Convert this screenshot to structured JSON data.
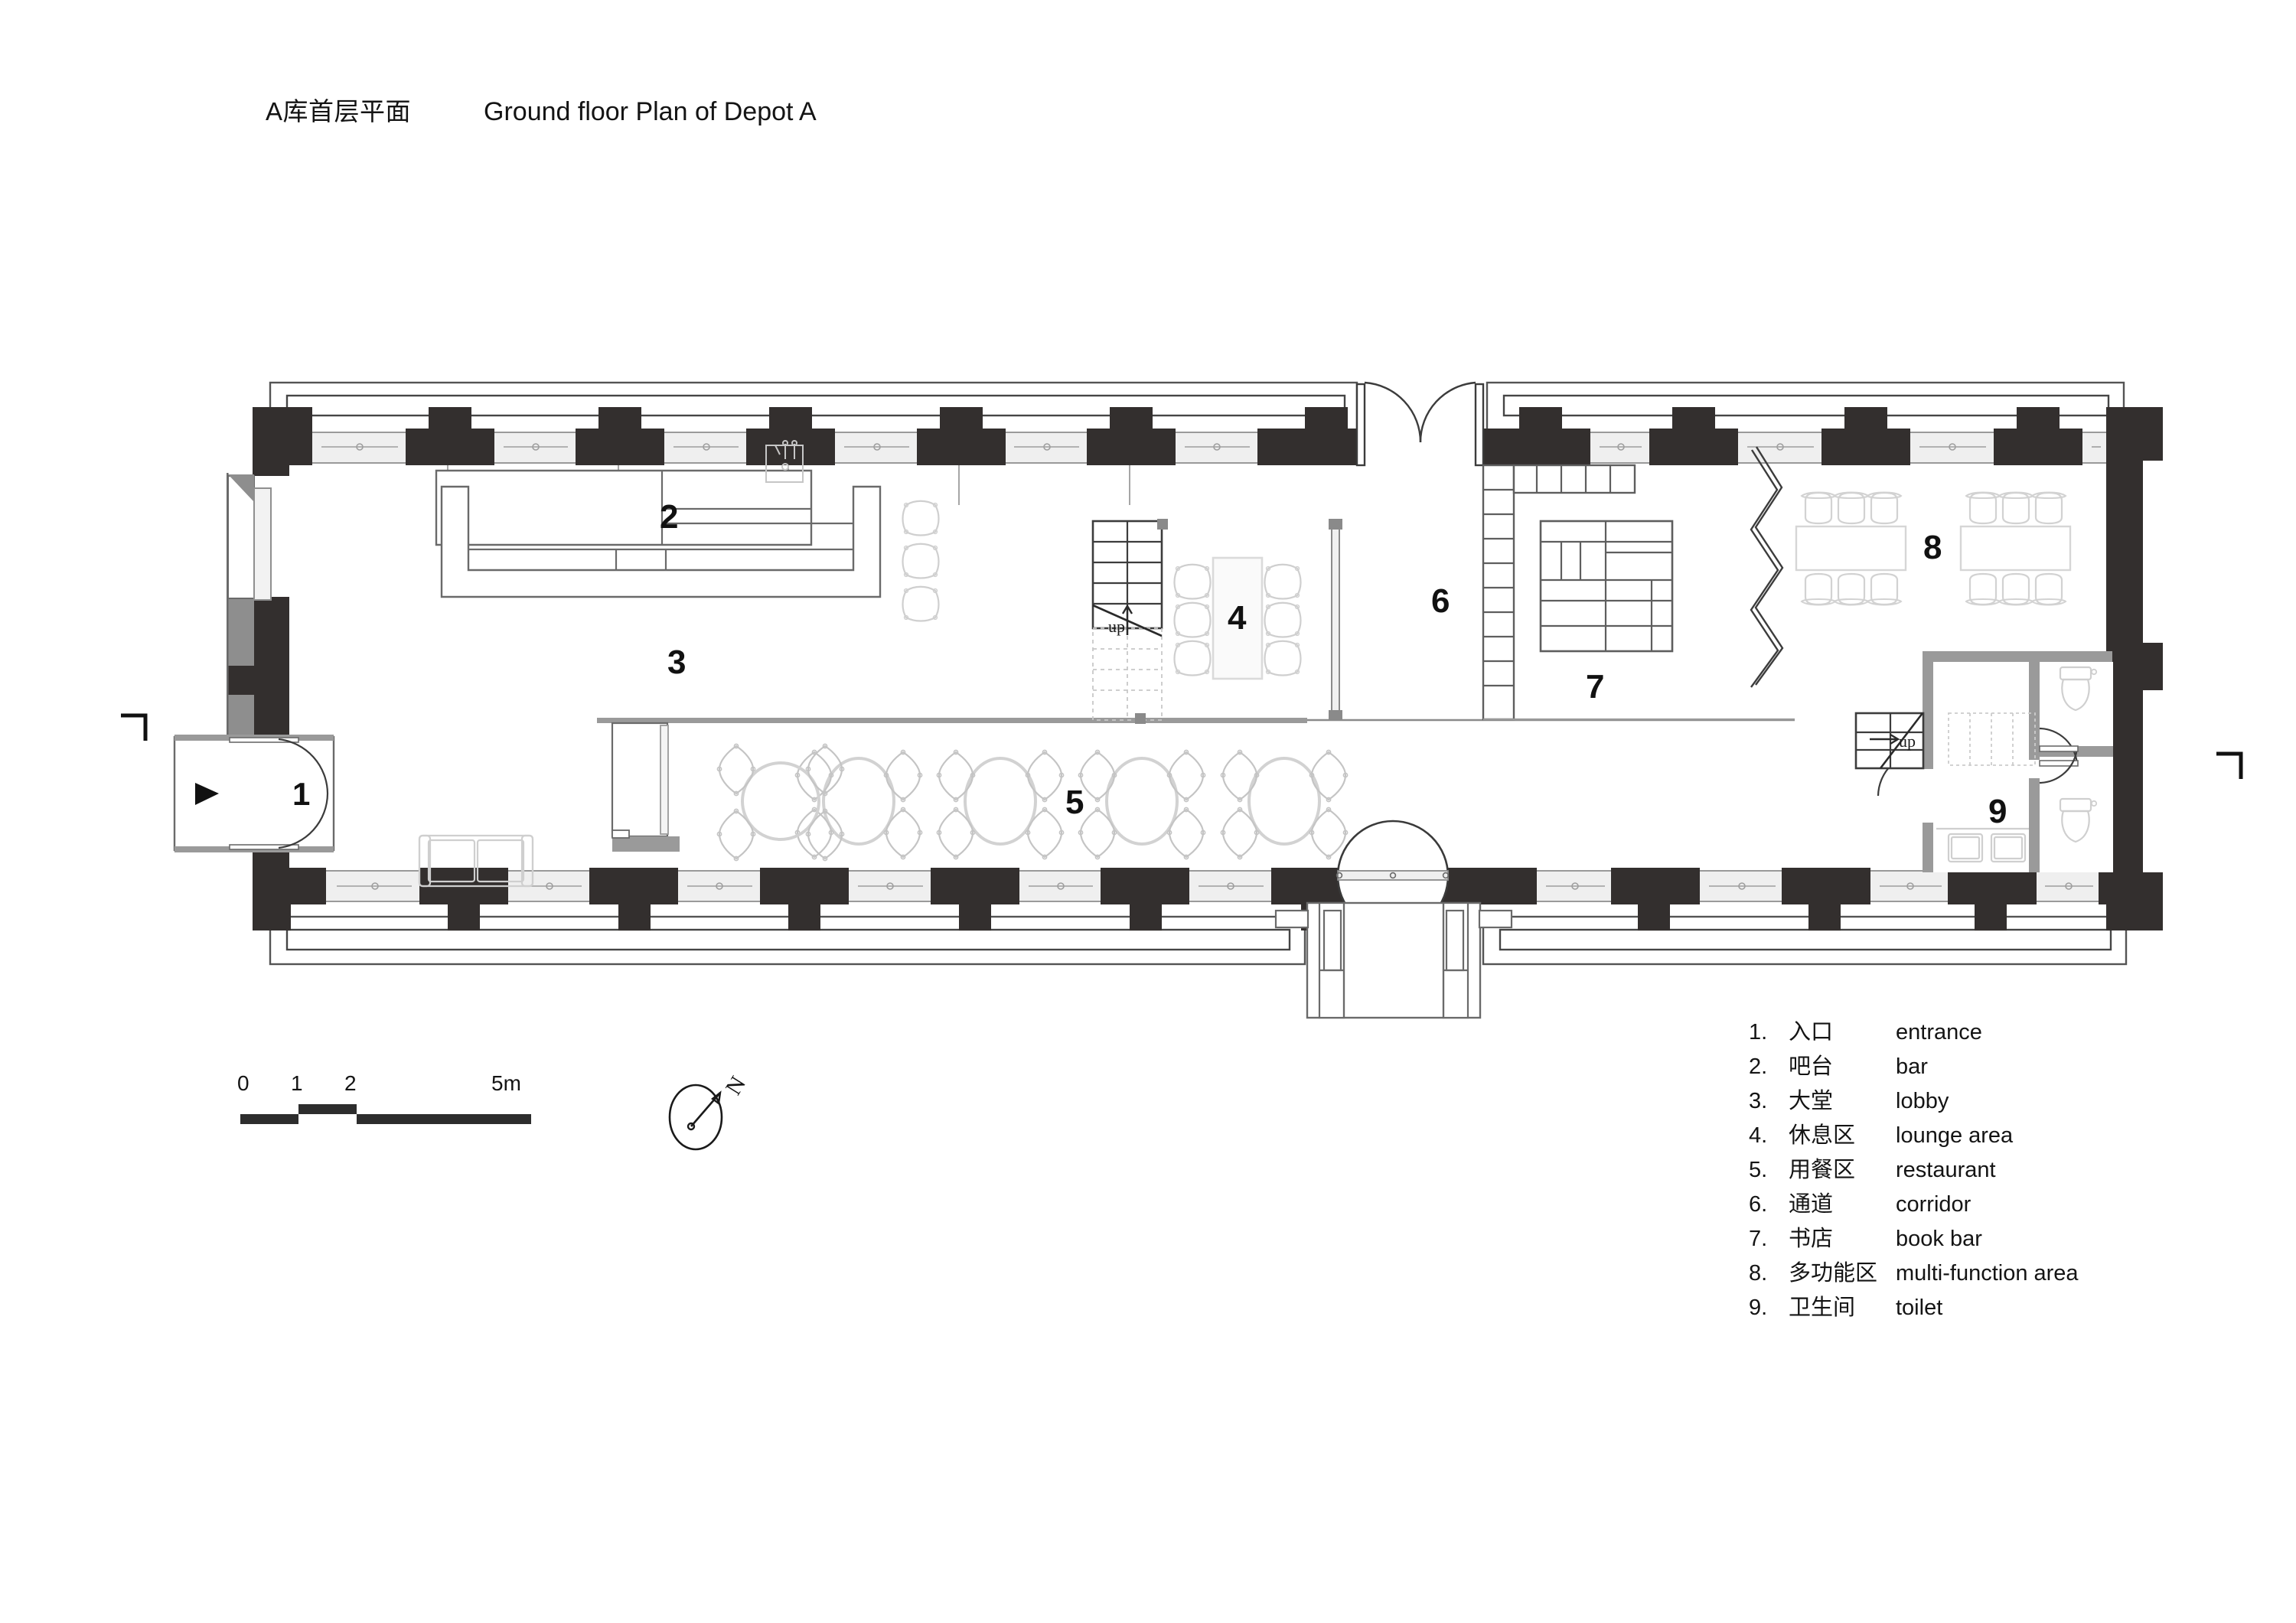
{
  "header": {
    "title_cn": "A库首层平面",
    "title_en": "Ground floor Plan of Depot A"
  },
  "plan": {
    "room_numbers": [
      "1",
      "2",
      "3",
      "4",
      "5",
      "6",
      "7",
      "8",
      "9"
    ],
    "stair_labels": [
      "up",
      "up"
    ],
    "colors": {
      "wall": "#332f2e",
      "partition": "#8e8e8e",
      "furniture_line": "#c9c9c9",
      "thin_line": "#6a6a6a",
      "text": "#141414",
      "paper": "#ffffff"
    }
  },
  "scale_bar": {
    "ticks": [
      "0",
      "1",
      "2",
      "5m"
    ],
    "unit": "m"
  },
  "north_arrow": {
    "label": "N"
  },
  "legend": {
    "items": [
      {
        "num": "1.",
        "cn": "入口",
        "en": "entrance"
      },
      {
        "num": "2.",
        "cn": "吧台",
        "en": "bar"
      },
      {
        "num": "3.",
        "cn": "大堂",
        "en": "lobby"
      },
      {
        "num": "4.",
        "cn": "休息区",
        "en": "lounge area"
      },
      {
        "num": "5.",
        "cn": "用餐区",
        "en": "restaurant"
      },
      {
        "num": "6.",
        "cn": "通道",
        "en": "corridor"
      },
      {
        "num": "7.",
        "cn": "书店",
        "en": "book bar"
      },
      {
        "num": "8.",
        "cn": "多功能区",
        "en": "multi-function area"
      },
      {
        "num": "9.",
        "cn": "卫生间",
        "en": "toilet"
      }
    ]
  }
}
